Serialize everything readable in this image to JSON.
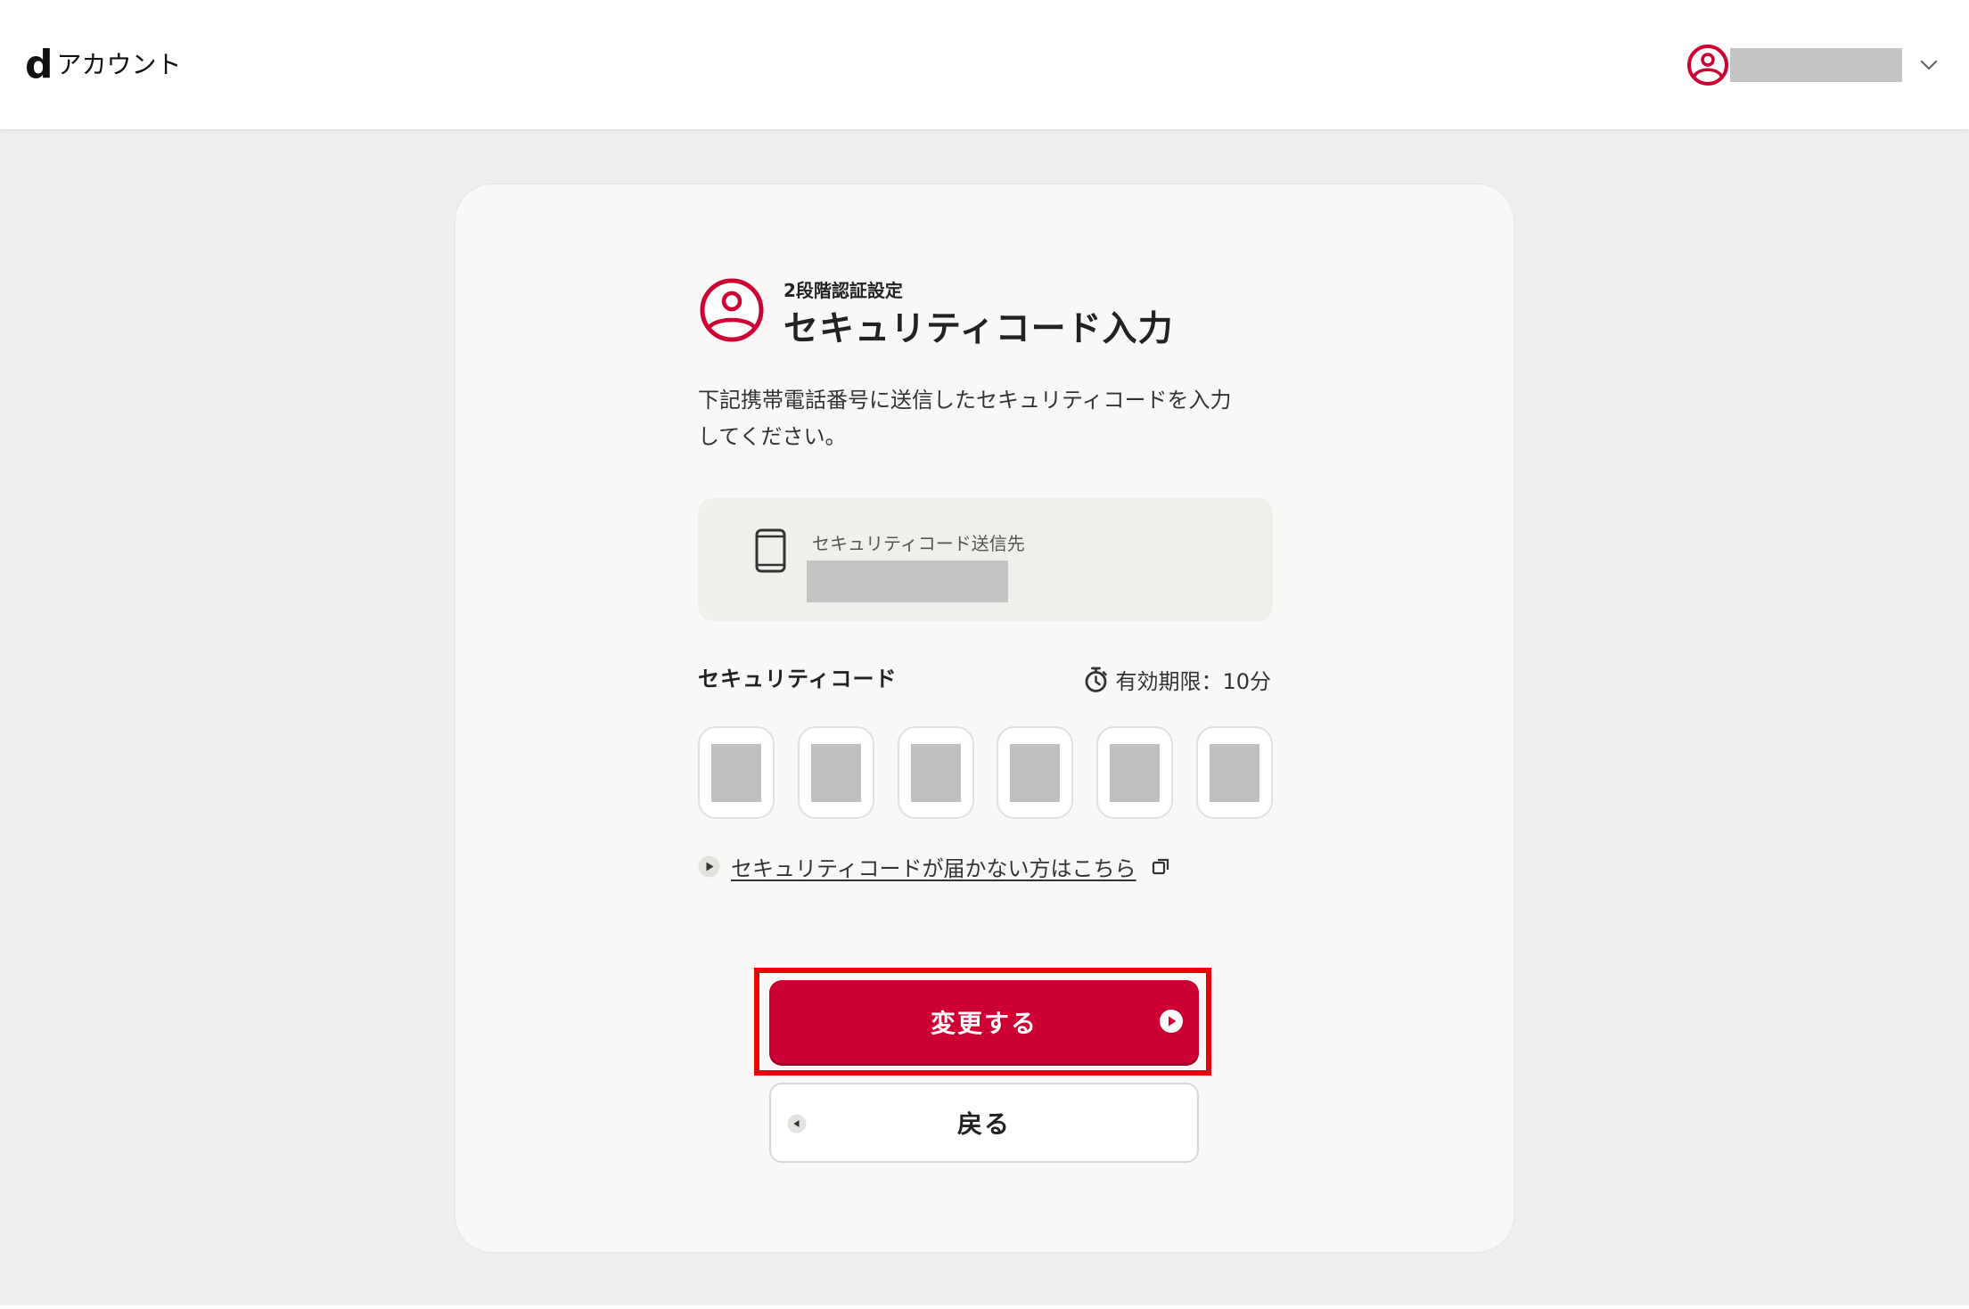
{
  "header": {
    "logo_mark": "d",
    "logo_text": "アカウント",
    "avatar_icon": "user-circle-icon",
    "menu_icon": "chevron-down-icon"
  },
  "heading": {
    "icon": "user-circle-icon",
    "subtitle": "2段階認証設定",
    "title": "セキュリティコード入力"
  },
  "description": {
    "line1": "下記携帯電話番号に送信したセキュリティコードを入力",
    "line2": "してください。"
  },
  "destination": {
    "icon": "smartphone-icon",
    "label": "セキュリティコード送信先"
  },
  "security_code": {
    "label": "セキュリティコード",
    "timer_icon": "stopwatch-icon",
    "expiry": "有効期限：10分"
  },
  "help_link": {
    "icon": "play-circle-icon",
    "text": "セキュリティコードが届かない方はこちら",
    "external_icon": "external-window-icon"
  },
  "actions": {
    "submit_label": "変更する",
    "submit_icon": "arrow-right-circle-icon",
    "back_label": "戻る",
    "back_icon": "arrow-left-circle-icon"
  },
  "colors": {
    "accent": "#cc0033",
    "highlight_frame": "#e60000",
    "page_background": "#efeeec",
    "card_background": "#f9f8f7"
  }
}
